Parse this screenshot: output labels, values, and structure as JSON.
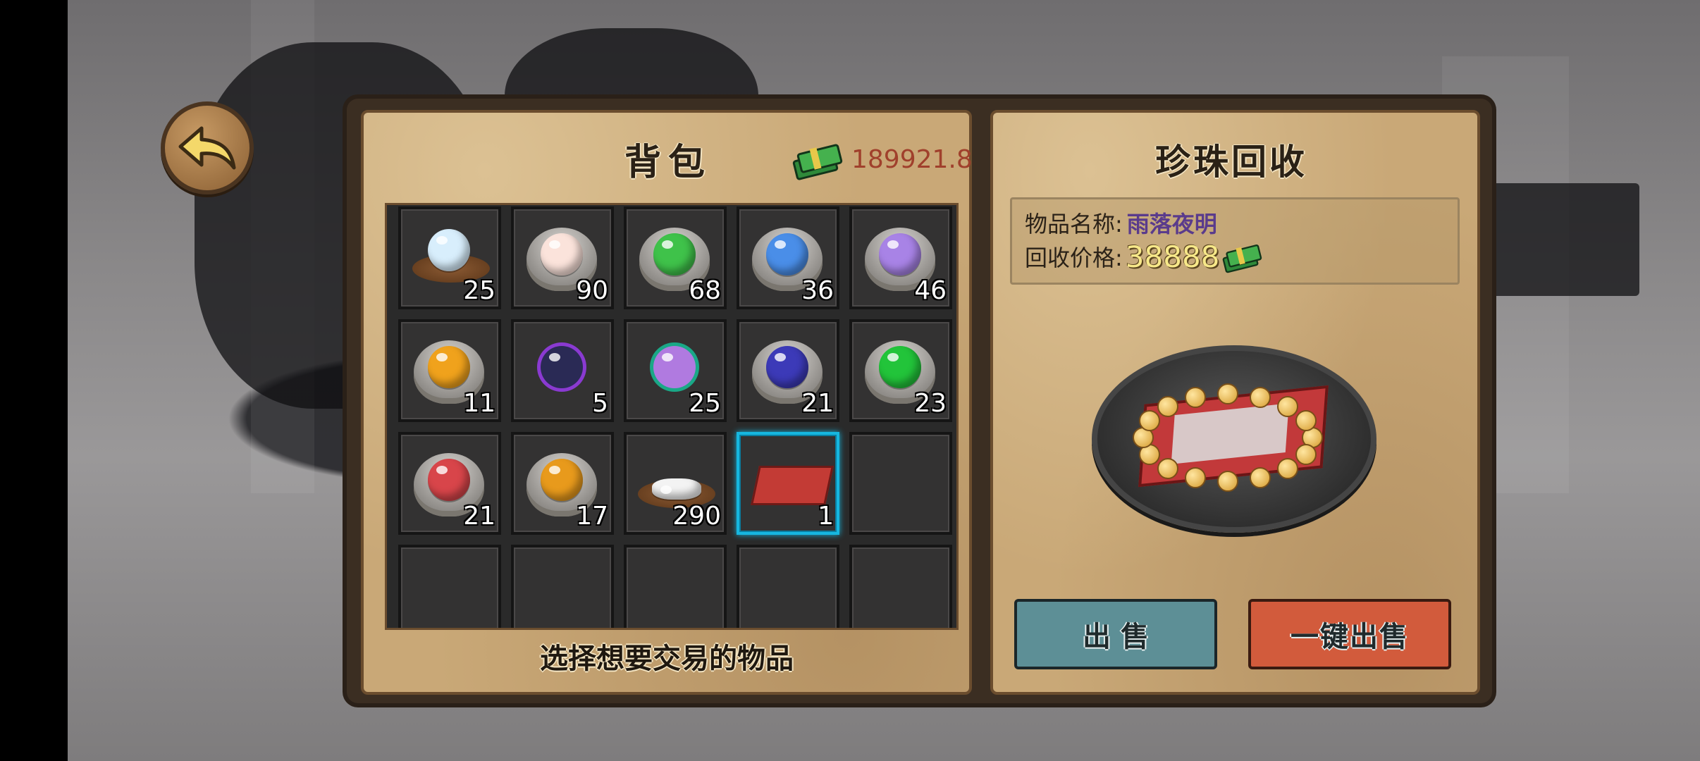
{
  "bag": {
    "title": "背包",
    "money": "189921.8",
    "hint": "选择想要交易的物品",
    "slots": [
      {
        "count": "25",
        "icon": "white-pearl-dish-icon",
        "color": "#d8eefc"
      },
      {
        "count": "90",
        "icon": "pink-pearl-shell-icon",
        "color": "#fbe3db"
      },
      {
        "count": "68",
        "icon": "green-pearl-shell-icon",
        "color": "#3fc24a"
      },
      {
        "count": "36",
        "icon": "blue-pearl-shell-icon",
        "color": "#4a8ee8"
      },
      {
        "count": "46",
        "icon": "purple-pearl-shell-icon",
        "color": "#a883e6"
      },
      {
        "count": "11",
        "icon": "gold-pearl-shell-icon",
        "color": "#f0a21c"
      },
      {
        "count": "5",
        "icon": "black-pearl-icon",
        "color": "#2a2a55"
      },
      {
        "count": "25",
        "icon": "rainbow-pearl-leaf-icon",
        "color": "#b07ae0"
      },
      {
        "count": "21",
        "icon": "indigo-pearl-shell-icon",
        "color": "#3c3ab8"
      },
      {
        "count": "23",
        "icon": "emerald-pearl-shell-icon",
        "color": "#22c43a"
      },
      {
        "count": "21",
        "icon": "red-pearl-shell-icon",
        "color": "#d8454a"
      },
      {
        "count": "17",
        "icon": "amber-pearl-shell-icon",
        "color": "#e89a1c"
      },
      {
        "count": "290",
        "icon": "small-pearls-dish-icon",
        "color": "#f3f3f3"
      },
      {
        "count": "1",
        "icon": "pearl-necklace-box-icon",
        "color": "#c33b35"
      },
      {
        "count": "",
        "icon": "empty-slot",
        "color": ""
      },
      {
        "count": "",
        "icon": "empty-slot",
        "color": ""
      },
      {
        "count": "",
        "icon": "empty-slot",
        "color": ""
      },
      {
        "count": "",
        "icon": "empty-slot",
        "color": ""
      },
      {
        "count": "",
        "icon": "empty-slot",
        "color": ""
      },
      {
        "count": "",
        "icon": "empty-slot",
        "color": ""
      }
    ],
    "selected_index": 13
  },
  "recycle": {
    "title": "珍珠回收",
    "name_label": "物品名称:",
    "item_name": "雨落夜明",
    "price_label": "回收价格:",
    "price": "38888",
    "sell_label": "出 售",
    "sell_all_label": "一键出售"
  }
}
